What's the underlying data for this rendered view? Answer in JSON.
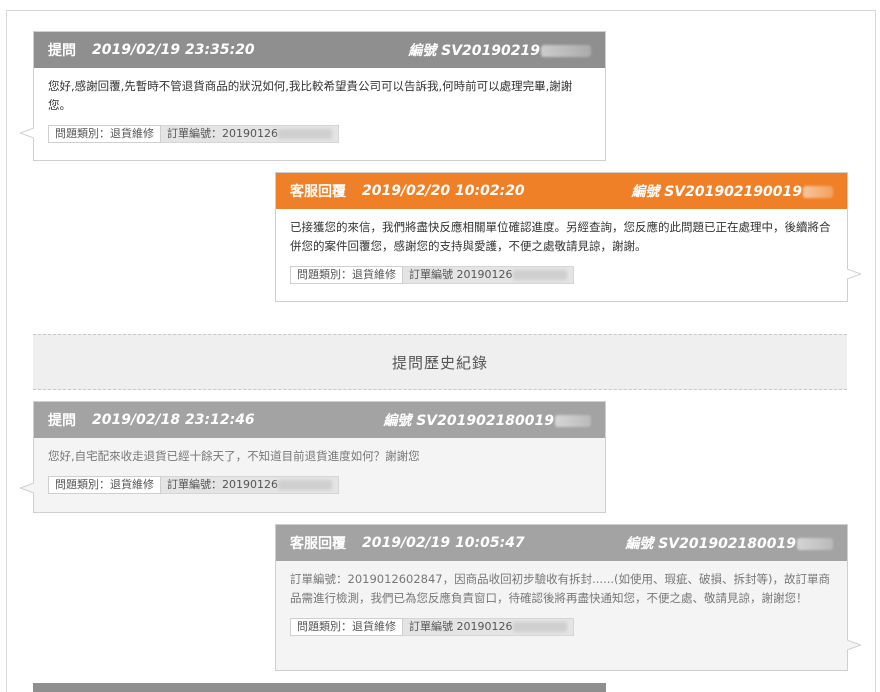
{
  "messages": [
    {
      "role": "提問",
      "time": "2019/02/19 23:35:20",
      "id_label": "編號",
      "id_value": "SV20190219",
      "text": "您好,感謝回覆,先暫時不管退貨商品的狀況如何,我比較希望貴公司可以告訴我,何時前可以處理完畢,謝謝您。",
      "category": "問題類別：退貨維修",
      "order": "訂單編號：20190126"
    },
    {
      "role": "客服回覆",
      "time": "2019/02/20 10:02:20",
      "id_label": "編號",
      "id_value": "SV201902190019",
      "text": "已接獲您的來信，我們將盡快反應相關單位確認進度。另經查詢，您反應的此問題已正在處理中，後續將合併您的案件回覆您，感謝您的支持與愛護，不便之處敬請見諒，謝謝。",
      "category": "問題類別：退貨維修",
      "order": "訂單編號 20190126"
    },
    {
      "role": "提問",
      "time": "2019/02/18 23:12:46",
      "id_label": "編號",
      "id_value": "SV201902180019",
      "text": "您好,自宅配來收走退貨已經十餘天了，不知道目前退貨進度如何？謝謝您",
      "category": "問題類別：退貨維修",
      "order": "訂單編號：20190126"
    },
    {
      "role": "客服回覆",
      "time": "2019/02/19 10:05:47",
      "id_label": "編號",
      "id_value": "SV201902180019",
      "text": "訂單編號：2019012602847，因商品收回初步驗收有拆封......(如使用、瑕疵、破損、拆封等)，故訂單商品需進行檢測，我們已為您反應負責窗口，待確認後將再盡快通知您，不便之處、敬請見諒，謝謝您！",
      "category": "問題類別：退貨維修",
      "order": "訂單編號 20190126"
    }
  ],
  "history_title": "提問歷史紀錄",
  "colors": {
    "orange": "#f08028",
    "gray": "#8f8f8f"
  }
}
